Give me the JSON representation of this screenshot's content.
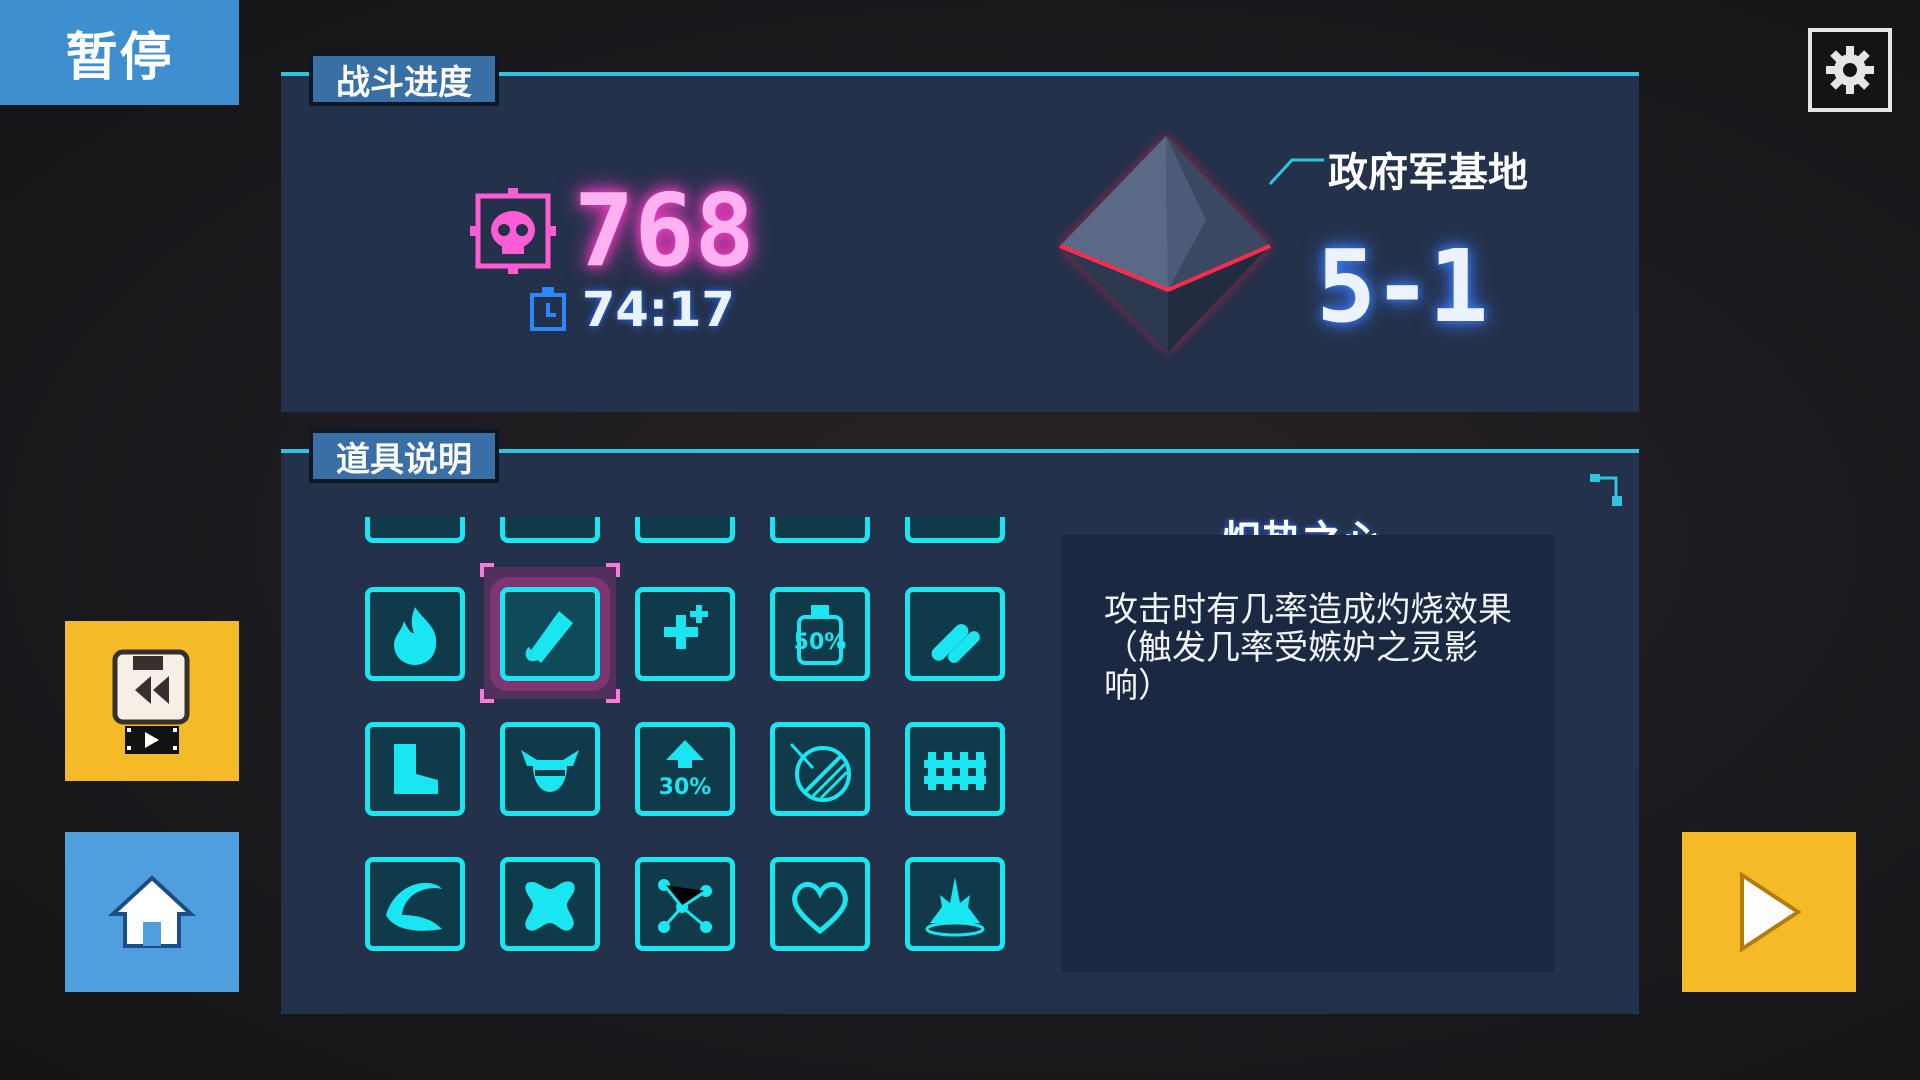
{
  "pause": {
    "title": "暂停"
  },
  "battle": {
    "section_label": "战斗进度",
    "kills": "768",
    "time": "74:17",
    "stage_name": "政府军基地",
    "stage_number": "5-1"
  },
  "items": {
    "section_label": "道具说明",
    "selected_index": 1,
    "grid": [
      {
        "icon": "flame-icon"
      },
      {
        "icon": "burning-sword-icon",
        "selected": true
      },
      {
        "icon": "crosses-heal-icon"
      },
      {
        "icon": "potion-50-icon",
        "label": "50%"
      },
      {
        "icon": "missiles-icon"
      },
      {
        "icon": "boot-icon"
      },
      {
        "icon": "winged-helmet-icon"
      },
      {
        "icon": "up-arrow-30-icon",
        "label": "30%"
      },
      {
        "icon": "shield-orb-icon"
      },
      {
        "icon": "fence-icon"
      },
      {
        "icon": "wave-icon"
      },
      {
        "icon": "splat-icon"
      },
      {
        "icon": "nodes-icon"
      },
      {
        "icon": "heart-icon"
      },
      {
        "icon": "explosion-icon"
      }
    ],
    "detail_title": "炽热之心",
    "detail_text": "攻击时有几率造成灼烧效果（触发几率受嫉妒之灵影响）"
  },
  "colors": {
    "accent": "#19e6f0",
    "kills": "#ff3cc8",
    "yellow": "#f2bb27",
    "blue": "#4f9fde"
  }
}
